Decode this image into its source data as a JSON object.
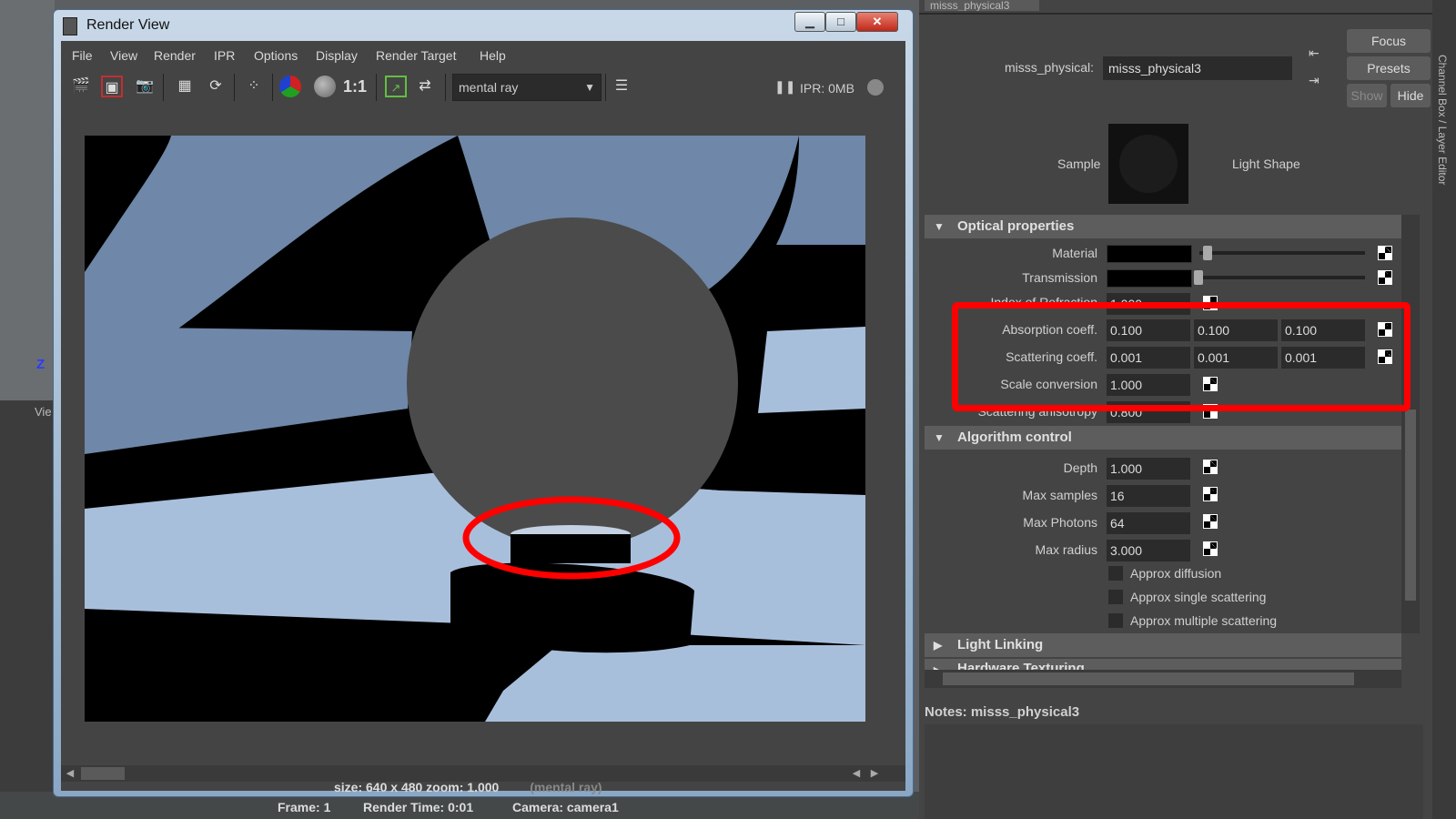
{
  "render_view": {
    "title": "Render View",
    "menu": [
      "File",
      "View",
      "Render",
      "IPR",
      "Options",
      "Display",
      "Render Target",
      "Help"
    ],
    "toolbar": {
      "ratio_label": "1:1",
      "renderer": "mental ray",
      "ipr_status": "IPR: 0MB"
    },
    "info": {
      "size_line": "size: 640 x 480 zoom: 1.000",
      "renderer_tag": "(mental ray)",
      "frame": "Frame: 1",
      "render_time": "Render Time: 0:01",
      "camera": "Camera: camera1"
    }
  },
  "attribute_editor": {
    "tab": "misss_physical3",
    "node_type_label": "misss_physical:",
    "node_name": "misss_physical3",
    "buttons": {
      "focus": "Focus",
      "presets": "Presets",
      "show": "Show",
      "hide": "Hide"
    },
    "sample_label": "Sample",
    "light_shape_label": "Light Shape",
    "sections": {
      "optical": "Optical properties",
      "algorithm": "Algorithm control",
      "light_linking": "Light Linking",
      "hardware_texturing": "Hardware Texturing"
    },
    "optical": {
      "material_label": "Material",
      "transmission_label": "Transmission",
      "ior_label": "Index of Refraction",
      "ior_value": "1.000",
      "absorption_label": "Absorption coeff.",
      "absorption": [
        "0.100",
        "0.100",
        "0.100"
      ],
      "scattering_label": "Scattering coeff.",
      "scattering": [
        "0.001",
        "0.001",
        "0.001"
      ],
      "scale_label": "Scale conversion",
      "scale_value": "1.000",
      "anisotropy_label": "Scattering anisotropy",
      "anisotropy_value": "0.800"
    },
    "algorithm": {
      "depth_label": "Depth",
      "depth_value": "1.000",
      "max_samples_label": "Max samples",
      "max_samples_value": "16",
      "max_photons_label": "Max Photons",
      "max_photons_value": "64",
      "max_radius_label": "Max radius",
      "max_radius_value": "3.000",
      "approx_diffusion": "Approx diffusion",
      "approx_single": "Approx single scattering",
      "approx_multiple": "Approx multiple scattering"
    },
    "notes_label": "Notes:",
    "notes_name": "misss_physical3"
  },
  "side_strip_text": "Channel Box / Layer Editor",
  "viewport": {
    "axis_label": "Z",
    "panel_label": "Vie"
  },
  "colors": {
    "highlight": "#ff0000",
    "floor_light": "#a8bfdc",
    "wall_blue": "#6f87a8",
    "sphere": "#4b4b4b"
  }
}
